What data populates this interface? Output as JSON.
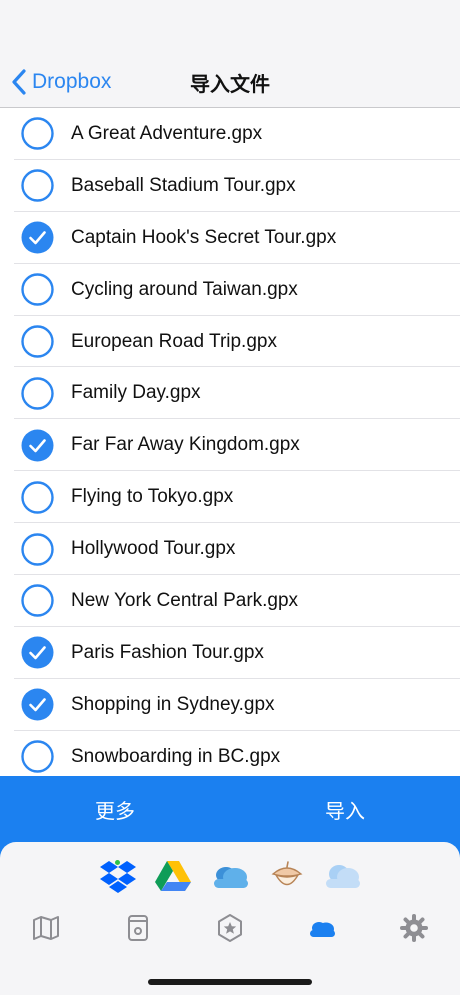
{
  "nav": {
    "back_label": "Dropbox",
    "title": "导入文件"
  },
  "files": [
    {
      "name": "A Great Adventure.gpx",
      "checked": false
    },
    {
      "name": "Baseball Stadium Tour.gpx",
      "checked": false
    },
    {
      "name": "Captain Hook's Secret Tour.gpx",
      "checked": true
    },
    {
      "name": "Cycling around Taiwan.gpx",
      "checked": false
    },
    {
      "name": "European Road Trip.gpx",
      "checked": false
    },
    {
      "name": "Family Day.gpx",
      "checked": false
    },
    {
      "name": "Far Far Away Kingdom.gpx",
      "checked": true
    },
    {
      "name": "Flying to Tokyo.gpx",
      "checked": false
    },
    {
      "name": "Hollywood Tour.gpx",
      "checked": false
    },
    {
      "name": "New York Central Park.gpx",
      "checked": false
    },
    {
      "name": "Paris Fashion Tour.gpx",
      "checked": true
    },
    {
      "name": "Shopping in Sydney.gpx",
      "checked": true
    },
    {
      "name": "Snowboarding in BC.gpx",
      "checked": false
    }
  ],
  "actions": {
    "more_label": "更多",
    "import_label": "导入"
  },
  "services": [
    "dropbox-icon",
    "google-drive-icon",
    "onedrive-icon",
    "acorn-icon",
    "icloud-icon"
  ],
  "tabs": [
    "map-icon",
    "device-icon",
    "badge-icon",
    "cloud-icon",
    "gear-icon"
  ],
  "colors": {
    "accent": "#1b80f0",
    "link": "#2b86f0",
    "active_dot": "#2cc24a",
    "tab_inactive": "#8e8e93"
  }
}
